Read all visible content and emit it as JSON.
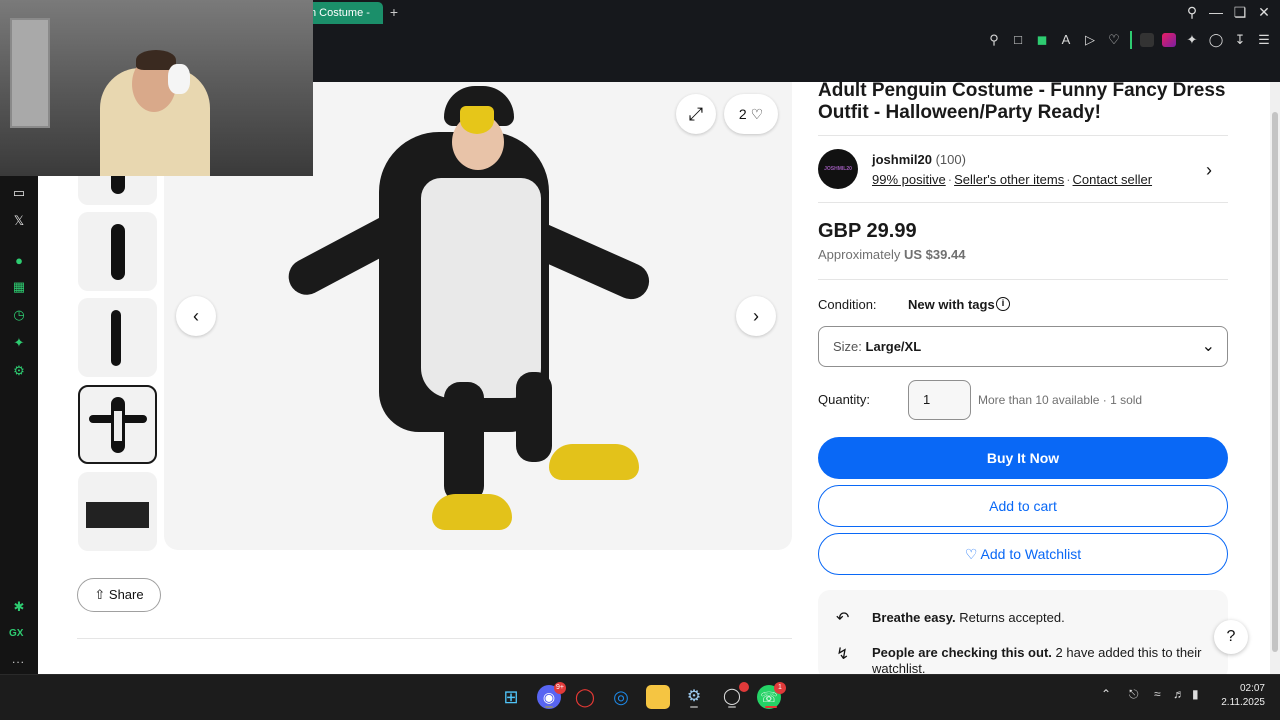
{
  "browser": {
    "tab_label": "n Costume -",
    "new_tab": "+",
    "window_controls": [
      "search-icon",
      "minimize-icon",
      "restore-icon",
      "close-icon"
    ],
    "toolbar_icons": [
      "pin-icon",
      "snapshot-icon",
      "shield-icon",
      "translate-icon",
      "play-icon",
      "heart-icon",
      "extension-dark-icon",
      "extension-pink-icon",
      "puzzle-icon",
      "wallet-icon",
      "download-icon",
      "menu-icon"
    ]
  },
  "sidebar": {
    "icons": [
      "twitch-icon",
      "x-icon",
      "music-icon",
      "grid-icon",
      "history-icon",
      "extensions-icon",
      "settings-icon",
      "sparkle-icon"
    ],
    "gx_label": "GX",
    "more": "..."
  },
  "gallery": {
    "counter": "2",
    "share_label": "Share"
  },
  "listing": {
    "title": "Adult Penguin Costume - Funny Fancy Dress Outfit - Halloween/Party Ready!",
    "seller": {
      "avatar_text": "JOSHMIL20",
      "name": "joshmil20",
      "feedback_count": "(100)",
      "positive": "99% positive",
      "other_items": "Seller's other items",
      "contact": "Contact seller"
    },
    "price": "GBP 29.99",
    "approx_prefix": "Approximately",
    "approx_value": "US $39.44",
    "condition_label": "Condition:",
    "condition_value": "New with tags",
    "size_label": "Size:",
    "size_value": "Large/XL",
    "quantity_label": "Quantity:",
    "quantity_value": "1",
    "availability": "More than 10 available · 1 sold",
    "buy_now": "Buy It Now",
    "add_to_cart": "Add to cart",
    "add_to_watchlist": "Add to Watchlist",
    "returns_bold": "Breathe easy.",
    "returns_text": "Returns accepted.",
    "watchers_bold": "People are checking this out.",
    "watchers_text": "2 have added this to their watchlist."
  },
  "taskbar": {
    "apps": [
      "windows-start-icon",
      "discord-icon",
      "opera-icon",
      "edge-icon",
      "file-explorer-icon",
      "steam-icon",
      "app-icon",
      "whatsapp-icon"
    ],
    "discord_badge": "9+",
    "whatsapp_badge": "1",
    "time": "02:07",
    "date": "2.11.2025"
  }
}
